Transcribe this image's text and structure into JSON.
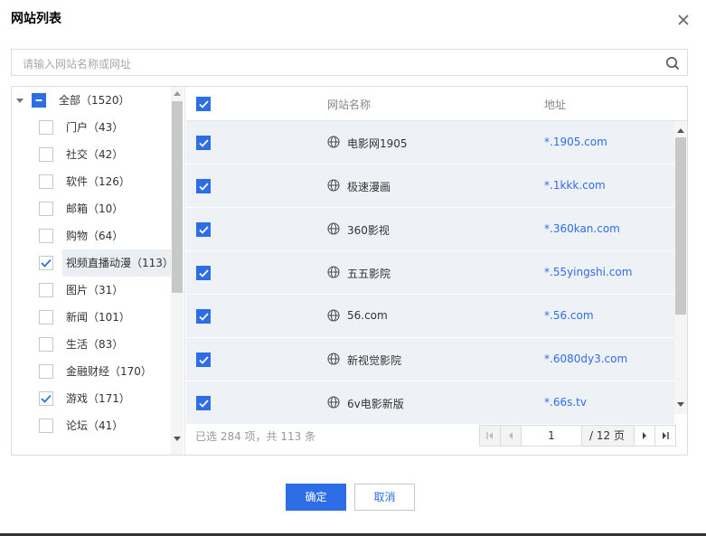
{
  "dialog": {
    "title": "网站列表",
    "search_placeholder": "请输入网站名称或网址",
    "confirm_label": "确定",
    "cancel_label": "取消"
  },
  "tree": {
    "items": [
      {
        "label": "全部（1520）",
        "state": "indeterminate",
        "expanded": true
      },
      {
        "label": "门户（43）",
        "state": "unchecked"
      },
      {
        "label": "社交（42）",
        "state": "unchecked"
      },
      {
        "label": "软件（126）",
        "state": "unchecked"
      },
      {
        "label": "邮箱（10）",
        "state": "unchecked"
      },
      {
        "label": "购物（64）",
        "state": "unchecked"
      },
      {
        "label": "视频直播动漫（113）",
        "state": "checked",
        "selected": true
      },
      {
        "label": "图片（31）",
        "state": "unchecked"
      },
      {
        "label": "新闻（101）",
        "state": "unchecked"
      },
      {
        "label": "生活（83）",
        "state": "unchecked"
      },
      {
        "label": "金融财经（170）",
        "state": "unchecked"
      },
      {
        "label": "游戏（171）",
        "state": "checked"
      },
      {
        "label": "论坛（41）",
        "state": "unchecked"
      }
    ]
  },
  "table": {
    "header_name": "网站名称",
    "header_addr": "地址",
    "rows": [
      {
        "name": "电影网1905",
        "addr": "*.1905.com",
        "checked": true
      },
      {
        "name": "极速漫画",
        "addr": "*.1kkk.com",
        "checked": true
      },
      {
        "name": "360影视",
        "addr": "*.360kan.com",
        "checked": true
      },
      {
        "name": "五五影院",
        "addr": "*.55yingshi.com",
        "checked": true
      },
      {
        "name": "56.com",
        "addr": "*.56.com",
        "checked": true
      },
      {
        "name": "新视觉影院",
        "addr": "*.6080dy3.com",
        "checked": true
      },
      {
        "name": "6v电影新版",
        "addr": "*.66s.tv",
        "checked": true
      }
    ],
    "summary": "已选 284 项，共 113 条",
    "page_current": "1",
    "page_total": "/ 12 页"
  },
  "colors": {
    "accent": "#2d6ee6",
    "row_bg": "#eef1f6"
  }
}
